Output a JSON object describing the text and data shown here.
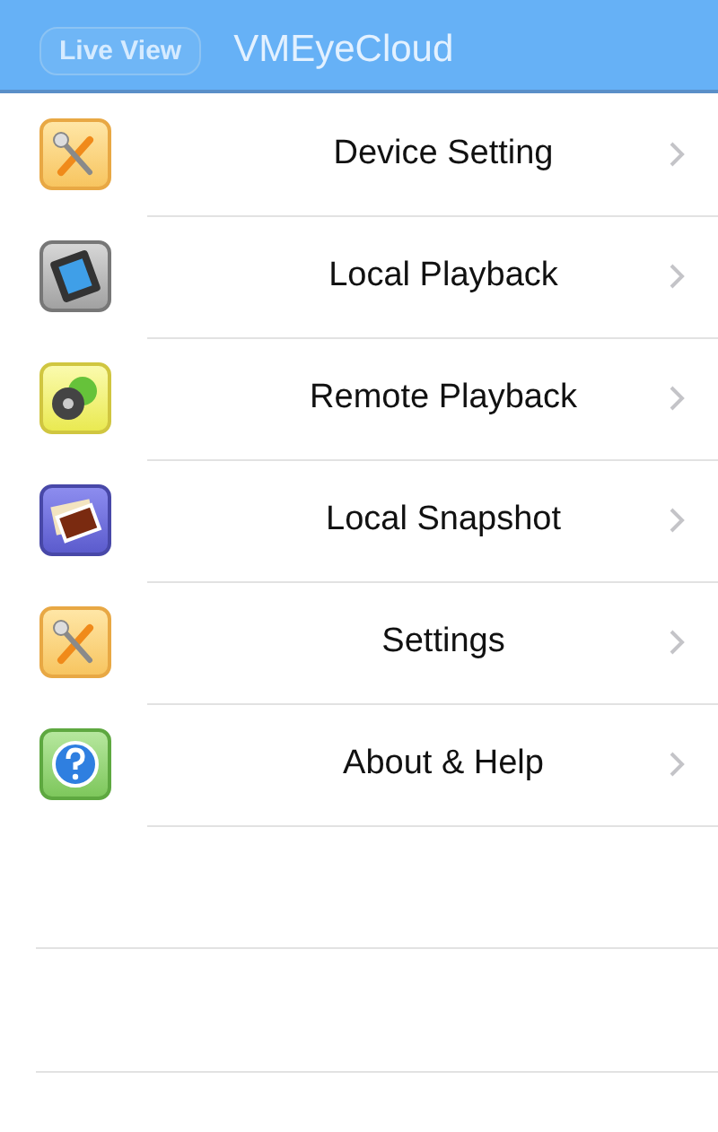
{
  "nav_bar": {
    "back_button": "Live View",
    "title": "VMEyeCloud"
  },
  "menu": [
    {
      "label": "Device Setting"
    },
    {
      "label": "Local Playback"
    },
    {
      "label": "Remote Playback"
    },
    {
      "label": "Local Snapshot"
    },
    {
      "label": "Settings"
    },
    {
      "label": "About & Help"
    }
  ]
}
